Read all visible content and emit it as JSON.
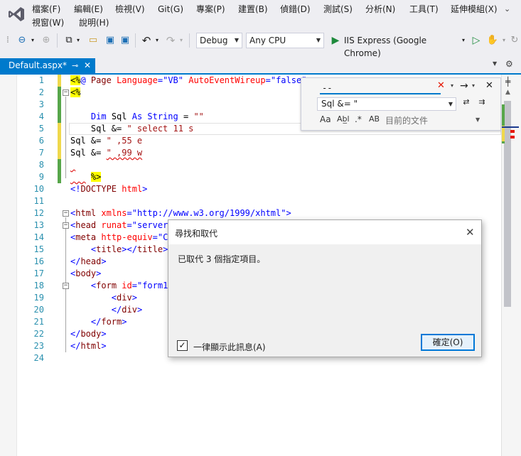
{
  "menu": {
    "items": [
      "檔案(F)",
      "編輯(E)",
      "檢視(V)",
      "Git(G)",
      "專案(P)",
      "建置(B)",
      "偵錯(D)",
      "測試(S)",
      "分析(N)",
      "工具(T)",
      "延伸模組(X)",
      "視窗(W)",
      "說明(H)"
    ]
  },
  "toolbar": {
    "configuration": "Debug",
    "platform": "Any CPU",
    "run_target": "IIS Express (Google Chrome)"
  },
  "document": {
    "tab_title": "Default.aspx*"
  },
  "editor": {
    "line_numbers": [
      "1",
      "2",
      "3",
      "4",
      "5",
      "6",
      "7",
      "8",
      "9",
      "10",
      "11",
      "12",
      "13",
      "14",
      "15",
      "16",
      "17",
      "18",
      "19",
      "20",
      "21",
      "22",
      "23",
      "24"
    ]
  },
  "find_replace": {
    "find_text": "--",
    "replace_text": "Sql &= \"",
    "option_match_case": "Aa",
    "option_whole_word": "Ab̲l",
    "option_regex": ".*",
    "option_preserve_case": "AB",
    "scope": "目前的文件"
  },
  "dialog": {
    "title": "尋找和取代",
    "message": "已取代 3 個指定項目。",
    "checkbox_label": "一律顯示此訊息(A)",
    "checkbox_checked": true,
    "ok_label": "確定(O)"
  },
  "colors": {
    "accent": "#007acc",
    "change_saved": "#57a64a",
    "change_unsaved": "#efd84c",
    "error_marker": "#e51400"
  }
}
